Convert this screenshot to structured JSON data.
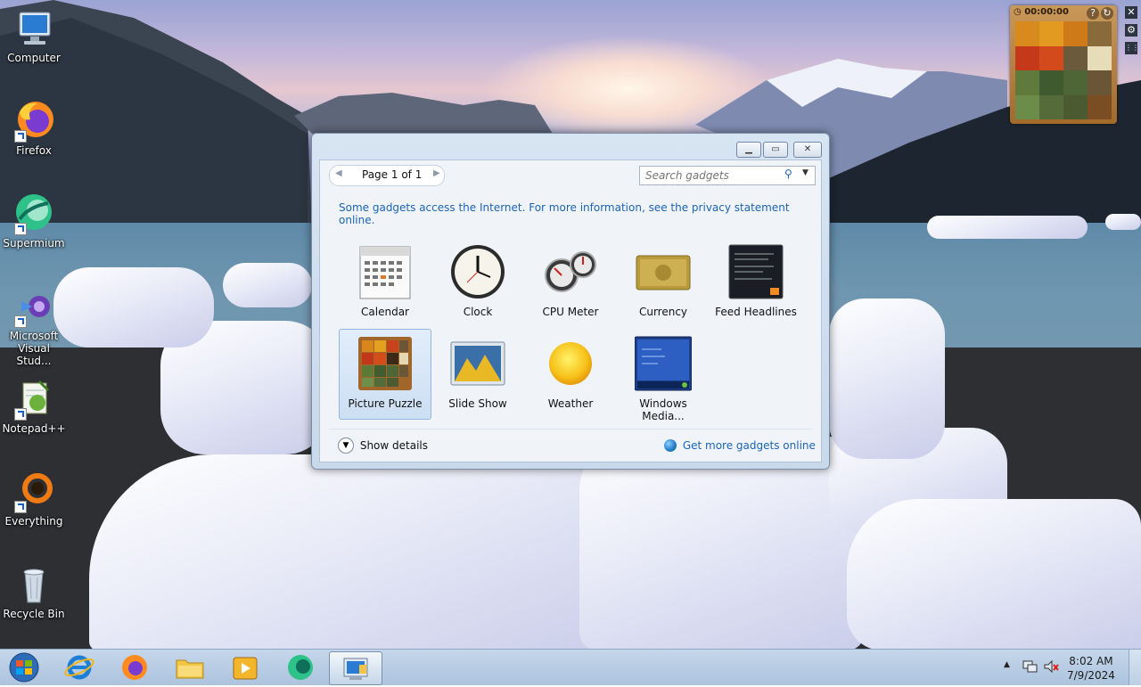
{
  "desktop": {
    "icons": [
      {
        "label": "Computer"
      },
      {
        "label": "Firefox"
      },
      {
        "label": "Supermium"
      },
      {
        "label": "Microsoft Visual Stud..."
      },
      {
        "label": "Notepad++"
      },
      {
        "label": "Everything"
      },
      {
        "label": "Recycle Bin"
      }
    ]
  },
  "puzzle_gadget": {
    "timer": "00:00:00"
  },
  "dialog": {
    "pager": {
      "page_label": "Page 1 of 1"
    },
    "search": {
      "placeholder": "Search gadgets"
    },
    "notice": "Some gadgets access the Internet.  For more information, see the privacy statement online.",
    "gadgets": [
      {
        "label": "Calendar"
      },
      {
        "label": "Clock"
      },
      {
        "label": "CPU Meter"
      },
      {
        "label": "Currency"
      },
      {
        "label": "Feed Headlines"
      },
      {
        "label": "Picture Puzzle",
        "selected": true
      },
      {
        "label": "Slide Show"
      },
      {
        "label": "Weather"
      },
      {
        "label": "Windows Media..."
      }
    ],
    "show_details": "Show details",
    "get_more": "Get more gadgets online"
  },
  "taskbar": {
    "clock": {
      "time": "8:02 AM",
      "date": "7/9/2024"
    }
  },
  "colors": {
    "link": "#1c64b5",
    "taskbar": "#b8cde4",
    "selection": "#cddff4"
  }
}
